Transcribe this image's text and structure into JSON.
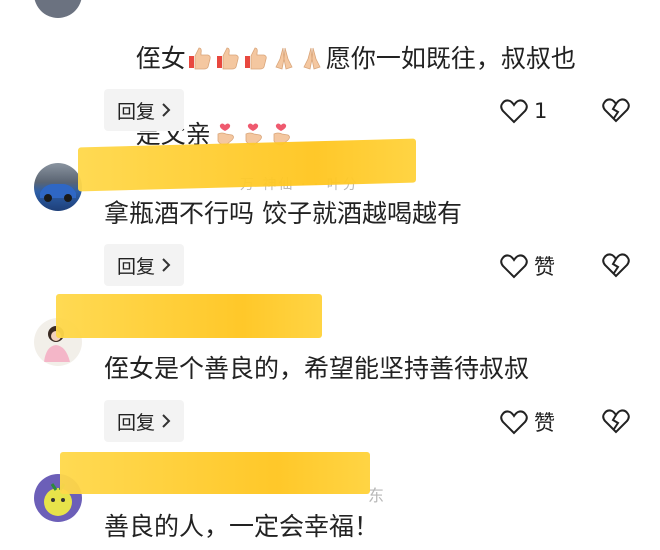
{
  "comments": [
    {
      "text_line1": "侄女",
      "text_mid": "愿你一如既往，叔叔也",
      "text_line2": "是父亲",
      "reply_label": "回复",
      "like_label": "1"
    },
    {
      "name_ghost": "万 神仙 · · 叶分",
      "text": "拿瓶酒不行吗 饺子就酒越喝越有",
      "reply_label": "回复",
      "like_label": "赞"
    },
    {
      "text": "侄女是个善良的，希望能坚持善待叔叔",
      "reply_label": "回复",
      "like_label": "赞"
    },
    {
      "name_ghost": "东",
      "text": "善良的人，一定会幸福！"
    }
  ],
  "icons": {
    "reply_chevron": "chevron-right-icon",
    "like": "heart-outline-icon",
    "dislike": "broken-heart-icon"
  }
}
